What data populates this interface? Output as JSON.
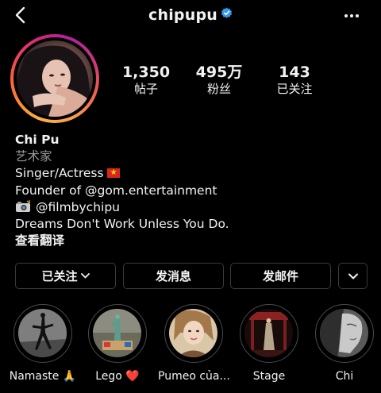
{
  "header": {
    "username": "chipupu",
    "back_icon": "chevron-left-icon",
    "verified_icon": "verified-badge-icon",
    "more_icon": "more-horizontal-icon",
    "verified_color": "#3897f0"
  },
  "stats": {
    "posts": {
      "count": "1,350",
      "label": "帖子"
    },
    "followers": {
      "count": "495万",
      "label": "粉丝"
    },
    "following": {
      "count": "143",
      "label": "已关注"
    }
  },
  "bio": {
    "name": "Chi Pu",
    "category": "艺术家",
    "line1": "Singer/Actress",
    "line2_prefix": "Founder of ",
    "line2_mention": "@gom.entertainment",
    "line3_mention": "@filmbychipu",
    "line4": "Dreams Don't Work Unless You Do.",
    "translate": "查看翻译"
  },
  "buttons": {
    "following": "已关注",
    "message": "发消息",
    "email": "发邮件",
    "more_icon": "chevron-down-icon"
  },
  "highlights": [
    {
      "label": "Namaste 🙏"
    },
    {
      "label": "Lego ❤️"
    },
    {
      "label": "Pumeo của..."
    },
    {
      "label": "Stage"
    },
    {
      "label": "Chi"
    }
  ]
}
